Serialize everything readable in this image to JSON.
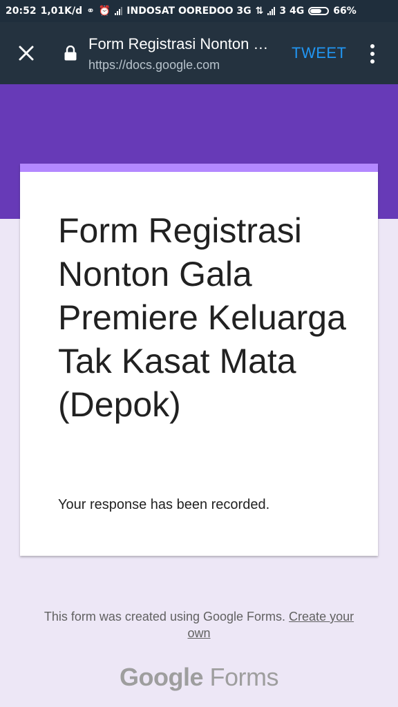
{
  "status_bar": {
    "time": "20:52",
    "speed": "1,01K/d",
    "carrier": "INDOSAT OOREDOO 3G",
    "network2": "3 4G",
    "battery": "66%"
  },
  "toolbar": {
    "title": "Form Registrasi Nonton Gala Premiere Keluarga Tak Kasat Mata (Depok)",
    "url": "https://docs.google.com",
    "tweet_label": "TWEET"
  },
  "form": {
    "title": "Form Registrasi Nonton Gala Premiere Keluarga Tak Kasat Mata (Depok)",
    "response_message": "Your response has been recorded.",
    "colors": {
      "header": "#673ab7",
      "accent": "#b388ff",
      "background": "#ede7f6"
    }
  },
  "footer": {
    "text": "This form was created using Google Forms.",
    "link": "Create your own"
  },
  "logo": {
    "brand": "Google",
    "product": "Forms"
  }
}
